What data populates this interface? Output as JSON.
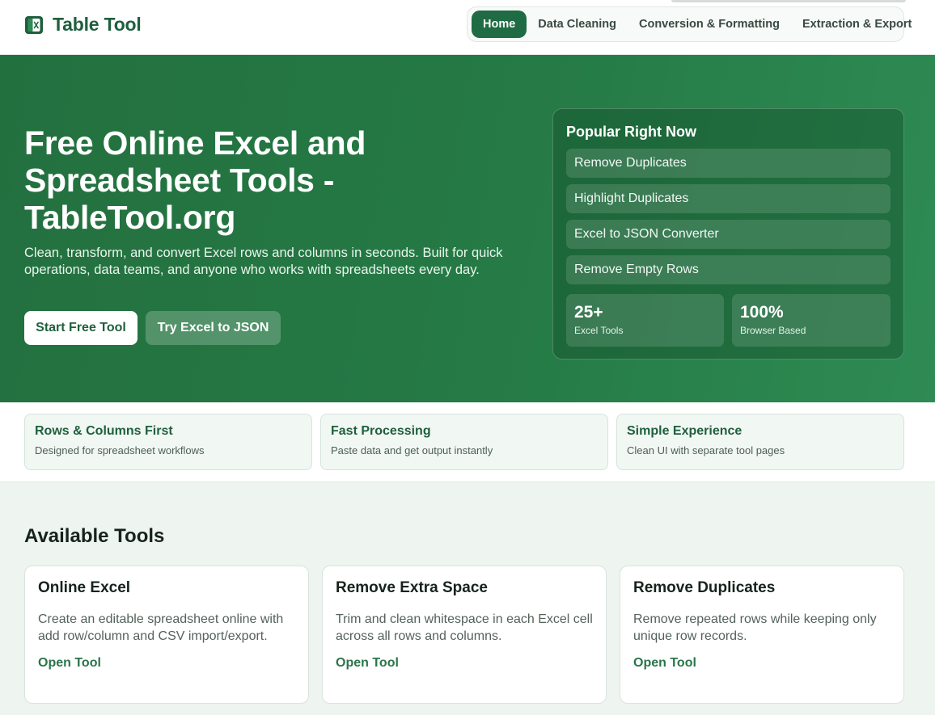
{
  "header": {
    "brand_name": "Table Tool",
    "nav": [
      {
        "label": "Home",
        "active": true
      },
      {
        "label": "Data Cleaning",
        "active": false
      },
      {
        "label": "Conversion & Formatting",
        "active": false
      },
      {
        "label": "Extraction & Export",
        "active": false
      }
    ]
  },
  "hero": {
    "title": "Free Online Excel and Spreadsheet Tools - TableTool.org",
    "subtitle": "Clean, transform, and convert Excel rows and columns in seconds. Built for quick operations, data teams, and anyone who works with spreadsheets every day.",
    "primary_button": "Start Free Tool",
    "secondary_button": "Try Excel to JSON"
  },
  "popular": {
    "title": "Popular Right Now",
    "items": [
      "Remove Duplicates",
      "Highlight Duplicates",
      "Excel to JSON Converter",
      "Remove Empty Rows"
    ],
    "stats": [
      {
        "value": "25+",
        "label": "Excel Tools"
      },
      {
        "value": "100%",
        "label": "Browser Based"
      }
    ]
  },
  "features": [
    {
      "title": "Rows & Columns First",
      "desc": "Designed for spreadsheet workflows"
    },
    {
      "title": "Fast Processing",
      "desc": "Paste data and get output instantly"
    },
    {
      "title": "Simple Experience",
      "desc": "Clean UI with separate tool pages"
    }
  ],
  "tools": {
    "heading": "Available Tools",
    "cards": [
      {
        "title": "Online Excel",
        "desc": "Create an editable spreadsheet online with add row/column and CSV import/export.",
        "link": "Open Tool"
      },
      {
        "title": "Remove Extra Space",
        "desc": "Trim and clean whitespace in each Excel cell across all rows and columns.",
        "link": "Open Tool"
      },
      {
        "title": "Remove Duplicates",
        "desc": "Remove repeated rows while keeping only unique row records.",
        "link": "Open Tool"
      }
    ]
  },
  "colors": {
    "brand": "#1f5f3d",
    "hero_bg": "#257a45",
    "accent_link": "#2a7549"
  },
  "icons": {
    "brand": "spreadsheet-logo-icon"
  }
}
